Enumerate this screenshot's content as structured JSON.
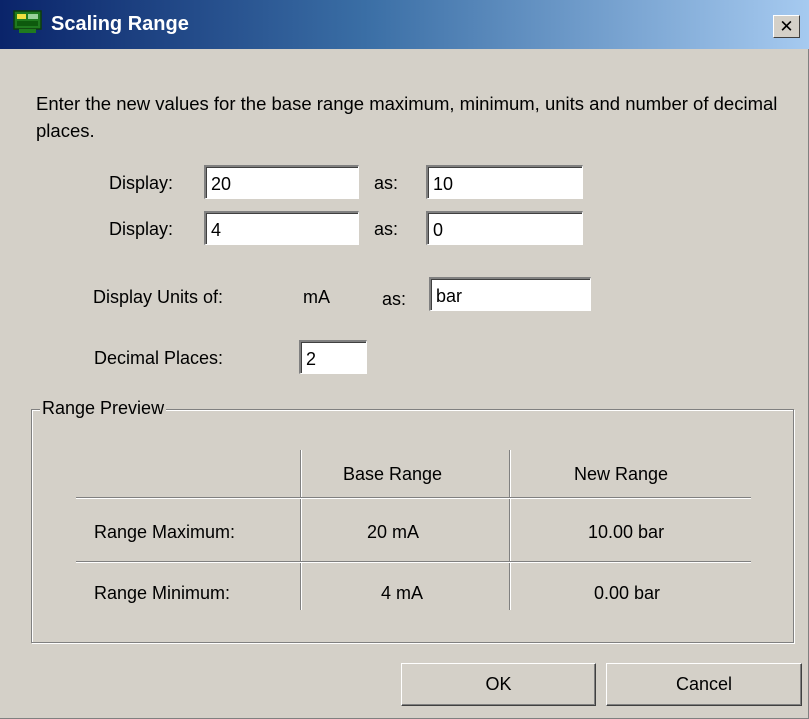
{
  "window": {
    "title": "Scaling Range"
  },
  "instruction": "Enter the new values for the base range maximum, minimum, units and number of decimal places.",
  "rows": [
    {
      "label": "Display:",
      "base_value": "20",
      "as_label": "as:",
      "new_value": "10"
    },
    {
      "label": "Display:",
      "base_value": "4",
      "as_label": "as:",
      "new_value": "0"
    }
  ],
  "units": {
    "label": "Display Units of:",
    "base_unit": "mA",
    "as_label": "as:",
    "new_unit": "bar"
  },
  "decimal_places": {
    "label": "Decimal Places:",
    "value": "2"
  },
  "preview": {
    "legend": "Range Preview",
    "headers": [
      "Base Range",
      "New Range"
    ],
    "rows": [
      {
        "label": "Range Maximum:",
        "base": "20 mA",
        "new": "10.00 bar"
      },
      {
        "label": "Range Minimum:",
        "base": "4 mA",
        "new": "0.00 bar"
      }
    ]
  },
  "buttons": {
    "ok": "OK",
    "cancel": "Cancel"
  }
}
